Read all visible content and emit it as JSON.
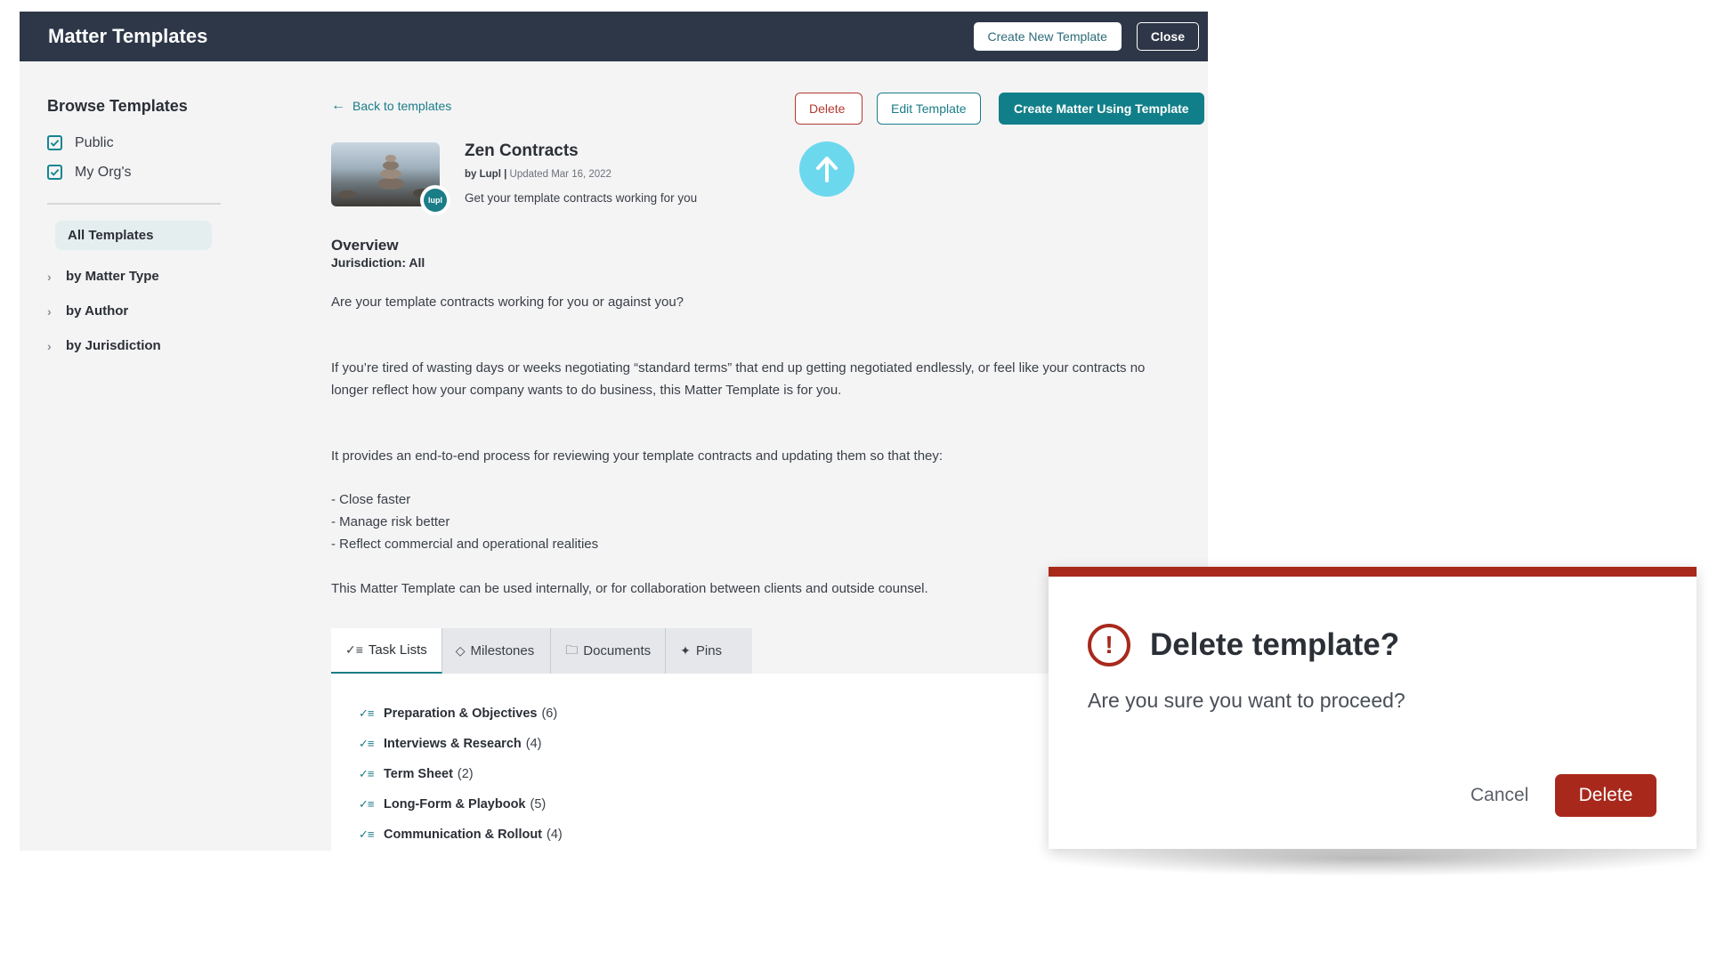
{
  "header": {
    "title": "Matter Templates",
    "create_new_label": "Create New Template",
    "close_label": "Close"
  },
  "sidebar": {
    "heading": "Browse Templates",
    "filters": [
      {
        "label": "Public",
        "checked": true
      },
      {
        "label": "My Org's",
        "checked": true
      }
    ],
    "all_templates": "All Templates",
    "groups": [
      "by Matter Type",
      "by Author",
      "by Jurisdiction"
    ]
  },
  "detail": {
    "back_label": "Back to templates",
    "delete_label": "Delete",
    "edit_label": "Edit Template",
    "create_matter_label": "Create Matter Using Template",
    "badge_text": "lupl",
    "title": "Zen Contracts",
    "author_prefix": "by Lupl |",
    "updated": "Updated Mar 16, 2022",
    "description": "Get your template contracts working for you",
    "overview_heading": "Overview",
    "jurisdiction": "Jurisdiction: All",
    "paragraphs": [
      "Are your template contracts working for you or against you?",
      "If you’re tired of wasting days or weeks negotiating “standard terms” that end up getting negotiated endlessly, or feel like your contracts no longer reflect how your company wants to do business, this Matter Template is for you.",
      "It provides an end-to-end process for reviewing your template contracts and updating them so that they:",
      "- Close faster",
      "- Manage risk better",
      "- Reflect commercial and operational realities",
      "This Matter Template can be used internally, or for collaboration between clients and outside counsel."
    ]
  },
  "tabs": [
    {
      "label": "Task Lists",
      "icon": "checklist-icon",
      "active": true
    },
    {
      "label": "Milestones",
      "icon": "milestone-icon",
      "active": false
    },
    {
      "label": "Documents",
      "icon": "folder-icon",
      "active": false
    },
    {
      "label": "Pins",
      "icon": "pin-icon",
      "active": false
    }
  ],
  "task_lists": [
    {
      "name": "Preparation & Objectives",
      "count": "(6)"
    },
    {
      "name": "Interviews & Research",
      "count": "(4)"
    },
    {
      "name": "Term Sheet",
      "count": "(2)"
    },
    {
      "name": "Long-Form & Playbook",
      "count": "(5)"
    },
    {
      "name": "Communication & Rollout",
      "count": "(4)"
    }
  ],
  "dialog": {
    "title": "Delete template?",
    "message": "Are you sure you want to proceed?",
    "cancel_label": "Cancel",
    "delete_label": "Delete",
    "accent_color": "#a8291c"
  },
  "colors": {
    "header_bg": "#2d3748",
    "teal": "#117f89",
    "danger": "#a8291c",
    "scroll_button": "#6cd8ee"
  }
}
